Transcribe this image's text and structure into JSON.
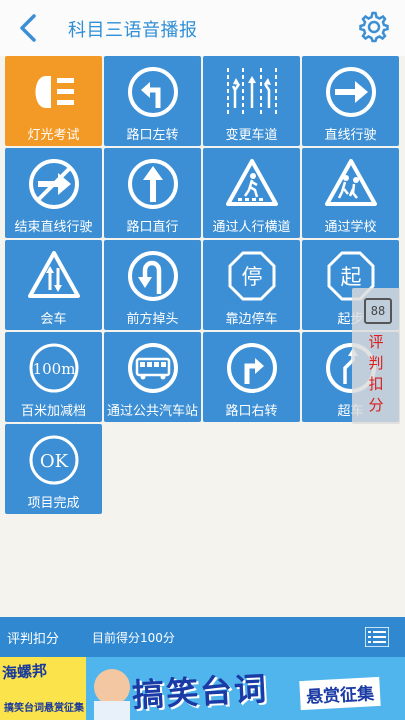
{
  "header": {
    "title": "科目三语音播报"
  },
  "tiles": [
    {
      "label": "灯光考试",
      "icon": "headlight-icon",
      "active": true
    },
    {
      "label": "路口左转",
      "icon": "turn-left-icon"
    },
    {
      "label": "变更车道",
      "icon": "lane-change-icon"
    },
    {
      "label": "直线行驶",
      "icon": "straight-arrow-icon"
    },
    {
      "label": "结束直线行驶",
      "icon": "end-straight-icon"
    },
    {
      "label": "路口直行",
      "icon": "go-straight-icon"
    },
    {
      "label": "通过人行横道",
      "icon": "pedestrian-crossing-icon"
    },
    {
      "label": "通过学校",
      "icon": "school-children-icon"
    },
    {
      "label": "会车",
      "icon": "two-way-traffic-icon"
    },
    {
      "label": "前方掉头",
      "icon": "u-turn-icon"
    },
    {
      "label": "靠边停车",
      "icon": "stop-sign-icon",
      "sign_text": "停"
    },
    {
      "label": "起步",
      "icon": "start-sign-icon",
      "sign_text": "起"
    },
    {
      "label": "百米加减档",
      "icon": "speed-100m-icon",
      "sign_text": "100m"
    },
    {
      "label": "通过公共汽车站",
      "icon": "bus-icon"
    },
    {
      "label": "路口右转",
      "icon": "turn-right-icon"
    },
    {
      "label": "超车",
      "icon": "overtake-icon"
    },
    {
      "label": "项目完成",
      "icon": "ok-icon",
      "sign_text": "OK"
    }
  ],
  "side_panel": {
    "badge": "88",
    "label": "评判扣分"
  },
  "bottom_bar": {
    "label": "评判扣分",
    "score": "目前得分100分"
  },
  "banner": {
    "brand": "海螺邦",
    "sub": "搞笑台词悬赏征集",
    "main": "搞笑台词",
    "tag": "悬赏征集"
  },
  "colors": {
    "tile": "#3c8fd4",
    "active_tile": "#f39a26",
    "bar": "#2f88d0",
    "title": "#2f8fd6",
    "warn": "#d91f1f"
  }
}
